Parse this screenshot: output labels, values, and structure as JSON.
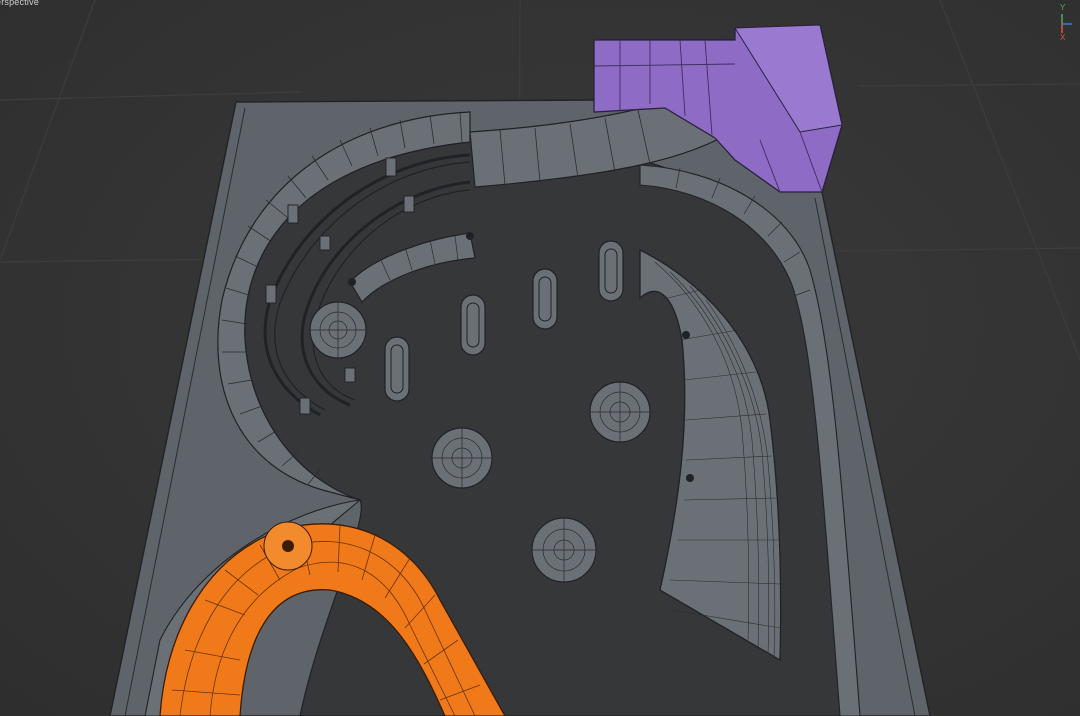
{
  "viewport": {
    "view_name": "erspective",
    "background_color": "#353535"
  },
  "axis_gizmo": {
    "y_label": "Y",
    "x_label": "X",
    "y_color": "#4caf50",
    "x_color": "#e0523a",
    "z_color": "#3d7bd9"
  },
  "scene": {
    "floor_color": "#5e646a",
    "wire_color": "#1f2226",
    "selected_orange": "#f07a1a",
    "selected_purple": "#8e6bc4",
    "objects": [
      "floor-plate",
      "curved-wall",
      "curved-ramp",
      "purple-stair-block",
      "orange-track",
      "curved-rails",
      "curved-bench",
      "capsule-lights",
      "dome-fixtures",
      "mesh-screen-wall"
    ]
  }
}
